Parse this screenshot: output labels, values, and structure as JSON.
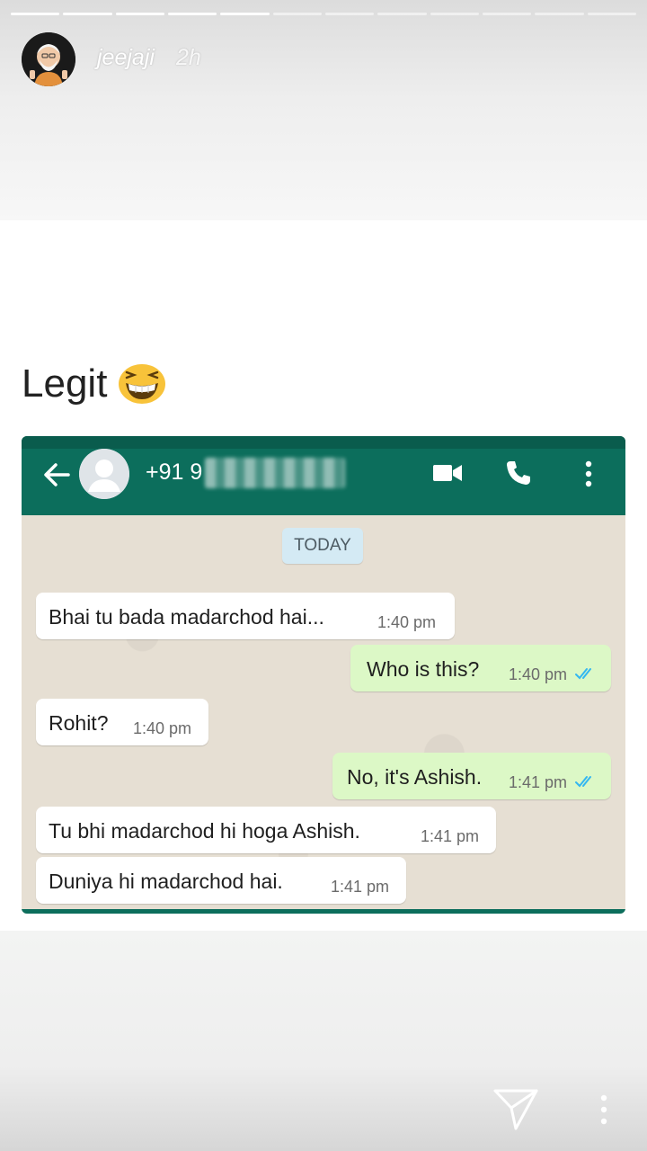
{
  "story": {
    "username": "jeejaji",
    "time_ago": "2h",
    "progress": {
      "total_segments": 12,
      "completed_segments": 5
    }
  },
  "post": {
    "caption": "Legit",
    "caption_emoji": "grinning-squinting-face-emoji"
  },
  "whatsapp": {
    "header": {
      "phone_visible": "+91 9",
      "icons": [
        "back-arrow-icon",
        "contact-avatar-icon",
        "video-call-icon",
        "voice-call-icon",
        "more-options-icon"
      ]
    },
    "date_chip": "TODAY",
    "messages": [
      {
        "direction": "incoming",
        "text": "Bhai tu bada madarchod hai...",
        "time": "1:40 pm"
      },
      {
        "direction": "outgoing",
        "text": "Who is this?",
        "time": "1:40 pm",
        "ticks": "read"
      },
      {
        "direction": "incoming",
        "text": "Rohit?",
        "time": "1:40 pm"
      },
      {
        "direction": "outgoing",
        "text": "No, it's Ashish.",
        "time": "1:41 pm",
        "ticks": "read"
      },
      {
        "direction": "incoming",
        "text": "Tu bhi madarchod hi hoga Ashish.",
        "time": "1:41 pm"
      },
      {
        "direction": "incoming",
        "text": "Duniya hi madarchod hai.",
        "time": "1:41 pm"
      }
    ],
    "colors": {
      "header": "#0c6e5c",
      "incoming_bubble": "#ffffff",
      "outgoing_bubble": "#dcf8c6",
      "read_ticks": "#34b7f1"
    }
  },
  "footer": {
    "icons": [
      "send-icon",
      "more-vertical-icon"
    ]
  }
}
